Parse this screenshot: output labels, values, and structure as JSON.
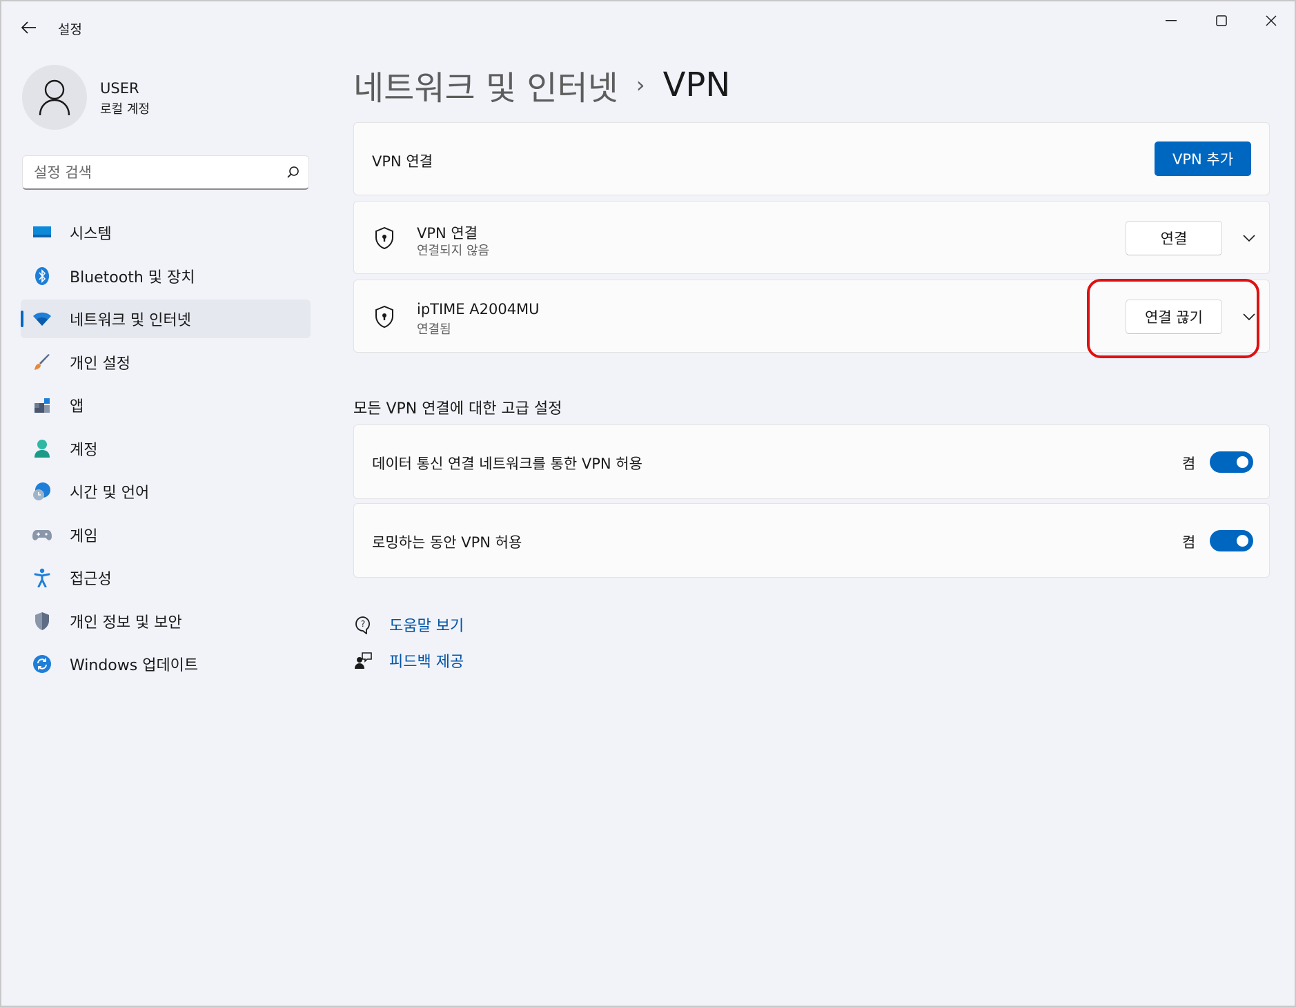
{
  "window": {
    "title": "설정"
  },
  "user": {
    "name": "USER",
    "account_type": "로컬 계정"
  },
  "search": {
    "placeholder": "설정 검색"
  },
  "sidebar": {
    "items": [
      {
        "label": "시스템",
        "icon": "system-icon"
      },
      {
        "label": "Bluetooth 및 장치",
        "icon": "bluetooth-icon"
      },
      {
        "label": "네트워크 및 인터넷",
        "icon": "wifi-icon",
        "active": true
      },
      {
        "label": "개인 설정",
        "icon": "brush-icon"
      },
      {
        "label": "앱",
        "icon": "apps-icon"
      },
      {
        "label": "계정",
        "icon": "person-icon"
      },
      {
        "label": "시간 및 언어",
        "icon": "clock-globe-icon"
      },
      {
        "label": "게임",
        "icon": "gamepad-icon"
      },
      {
        "label": "접근성",
        "icon": "accessibility-icon"
      },
      {
        "label": "개인 정보 및 보안",
        "icon": "shield-icon"
      },
      {
        "label": "Windows 업데이트",
        "icon": "update-icon"
      }
    ]
  },
  "breadcrumb": {
    "parent": "네트워크 및 인터넷",
    "separator": "›",
    "current": "VPN"
  },
  "vpn_header": {
    "title": "VPN 연결",
    "add_button": "VPN 추가"
  },
  "vpn_connections": [
    {
      "name": "VPN 연결",
      "status": "연결되지 않음",
      "action": "연결"
    },
    {
      "name": "ipTIME A2004MU",
      "status": "연결됨",
      "action": "연결 끊기"
    }
  ],
  "advanced": {
    "title": "모든 VPN 연결에 대한 고급 설정",
    "settings": [
      {
        "label": "데이터 통신 연결 네트워크를 통한 VPN 허용",
        "state": "켬"
      },
      {
        "label": "로밍하는 동안 VPN 허용",
        "state": "켬"
      }
    ]
  },
  "links": {
    "help": "도움말 보기",
    "feedback": "피드백 제공"
  },
  "colors": {
    "accent": "#0067c0",
    "highlight": "#e01010"
  }
}
